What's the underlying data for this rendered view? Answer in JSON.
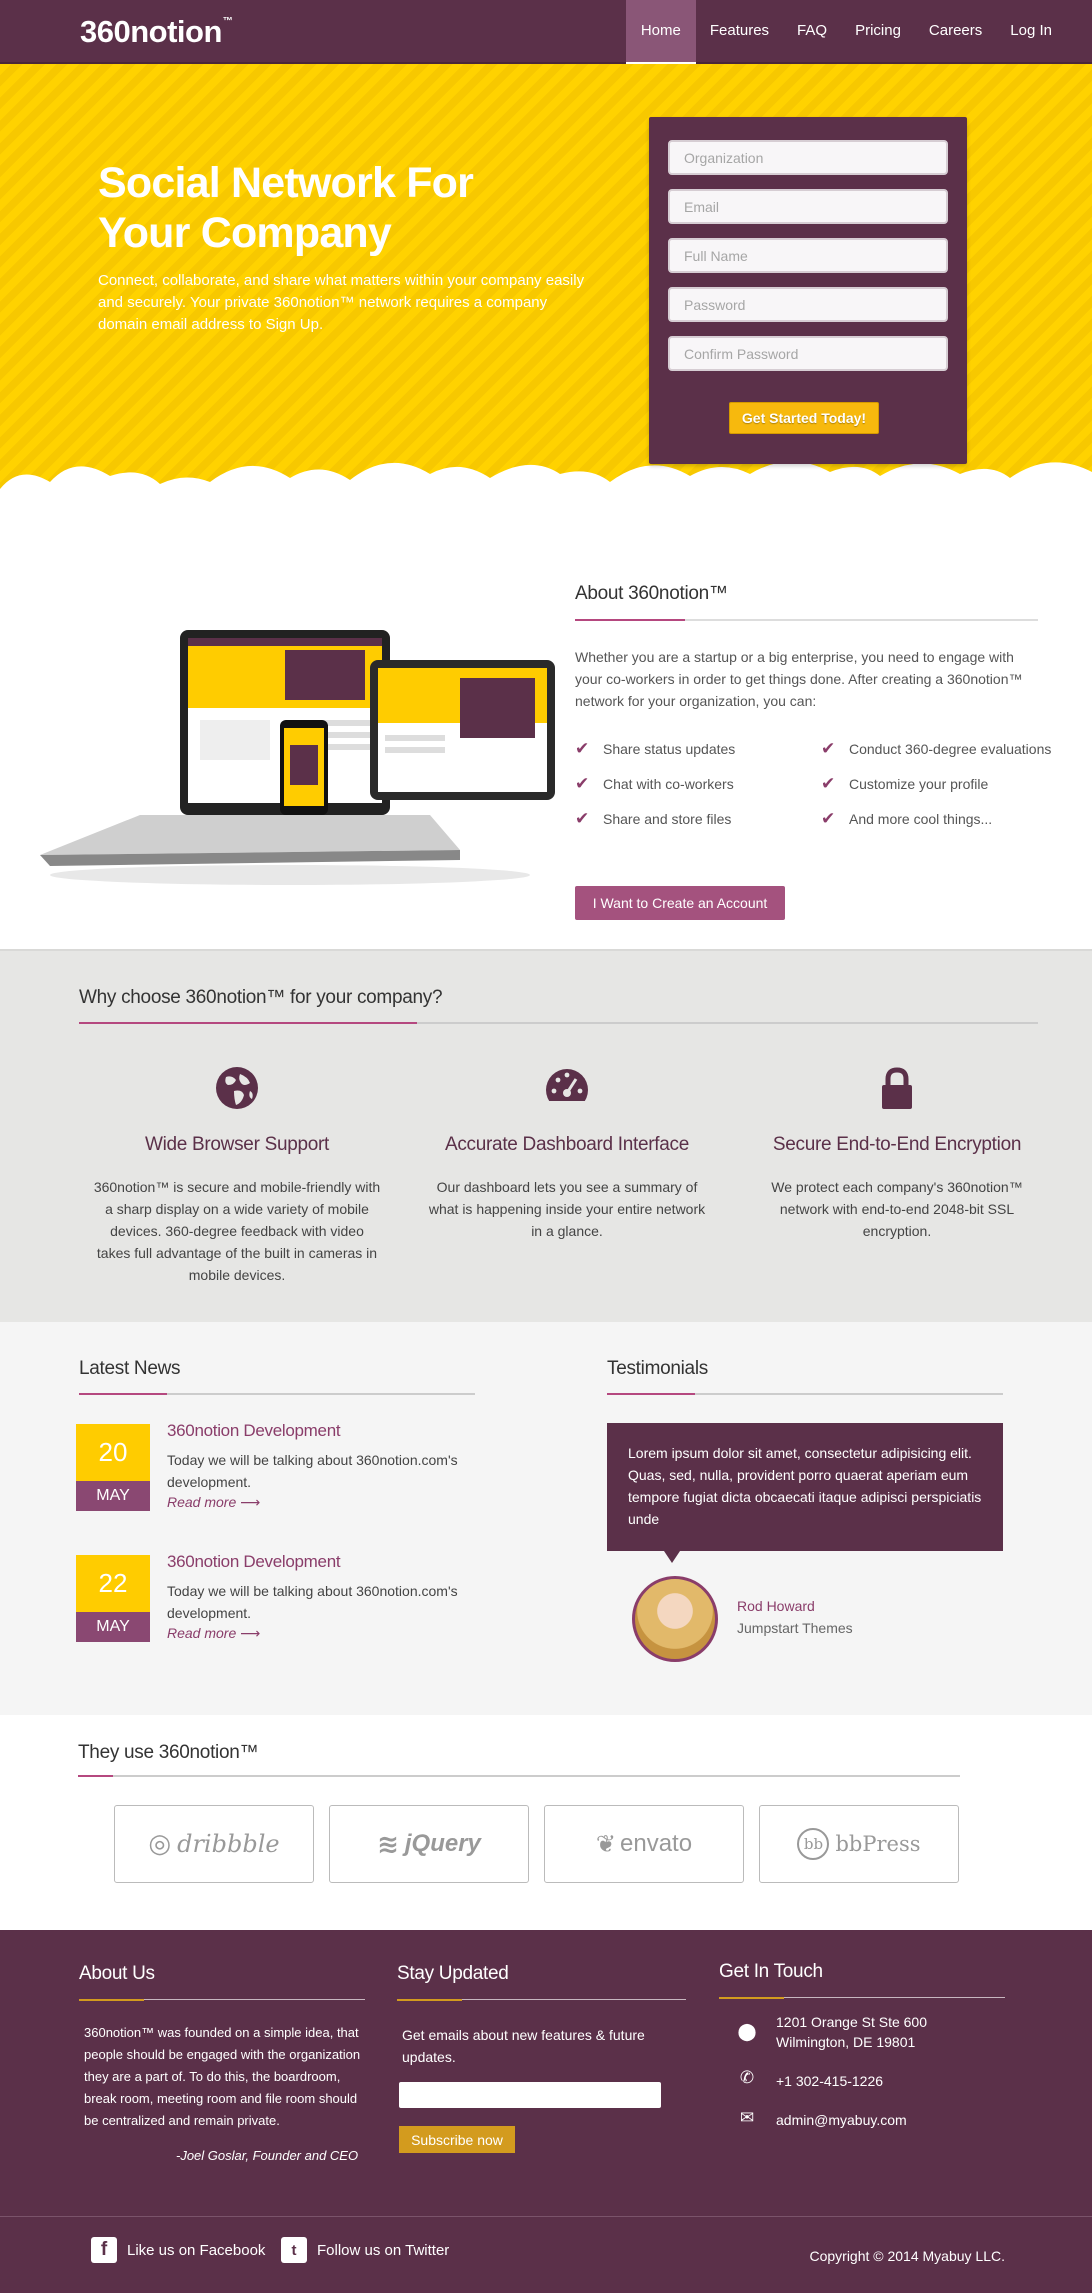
{
  "header": {
    "logo": "360notion",
    "logo_tm": "™",
    "nav": [
      "Home",
      "Features",
      "FAQ",
      "Pricing",
      "Careers",
      "Log In"
    ]
  },
  "hero": {
    "title": "Social Network For Your Company",
    "description": "Connect, collaborate, and share what matters within your company easily and securely. Your private 360notion™ network requires a company domain email address to Sign Up.",
    "form": {
      "organization_placeholder": "Organization",
      "email_placeholder": "Email",
      "fullname_placeholder": "Full Name",
      "password_placeholder": "Password",
      "confirm_placeholder": "Confirm Password",
      "submit_label": "Get Started Today!"
    }
  },
  "about": {
    "title": "About 360notion™",
    "text": "Whether you are a startup or a big enterprise, you need to engage with your co-workers in order to get things done. After creating a 360notion™ network for your organization, you can:",
    "items": [
      "Share status updates",
      "Conduct 360-degree  evaluations",
      "Chat with co-workers",
      "Customize your profile",
      "Share and store files",
      "And more cool things..."
    ],
    "button": "I Want to Create an Account",
    "check_icon": "check-icon"
  },
  "why": {
    "title": "Why choose 360notion™  for your company?",
    "features": [
      {
        "icon": "globe-icon",
        "title": "Wide Browser Support",
        "text": "360notion™ is secure and mobile-friendly with a sharp display on a wide variety of mobile devices. 360-degree feedback with video takes full advantage of the built in cameras in mobile devices."
      },
      {
        "icon": "dashboard-icon",
        "title": "Accurate Dashboard Interface",
        "text": "Our dashboard lets you see a summary of what is happening inside your entire network in a glance."
      },
      {
        "icon": "lock-icon",
        "title": "Secure End-to-End Encryption",
        "text": "We protect each company's 360notion™ network with end-to-end 2048-bit SSL encryption."
      }
    ]
  },
  "news": {
    "title": "Latest News",
    "items": [
      {
        "day": "20",
        "month": "MAY",
        "heading": "360notion Development",
        "text": "Today we will be talking about 360notion.com's development.",
        "more": "Read more ⟶"
      },
      {
        "day": "22",
        "month": "MAY",
        "heading": "360notion Development",
        "text": "Today we will be talking about 360notion.com's development.",
        "more": "Read more ⟶"
      }
    ]
  },
  "testimonials": {
    "title": "Testimonials",
    "quote": "Lorem ipsum dolor sit amet, consectetur adipisicing elit. Quas, sed, nulla, provident porro quaerat aperiam eum tempore fugiat dicta obcaecati itaque adipisci perspiciatis unde",
    "name": "Rod Howard",
    "company": "Jumpstart Themes"
  },
  "clients": {
    "title": "They use 360notion™",
    "logos": [
      "dribbble",
      "jQuery",
      "envato",
      "bbPress"
    ]
  },
  "footer": {
    "about_title": "About Us",
    "about_text": "360notion™ was founded on a simple idea, that people should be engaged with the organization they are a part of. To do this, the boardroom, break room, meeting room and file room should be centralized and remain private.",
    "about_author": "-Joel Goslar, Founder and CEO",
    "stay_title": "Stay Updated",
    "stay_text": "Get emails about new features & future updates.",
    "subscribe": "Subscribe now",
    "touch_title": "Get In Touch",
    "address1": "1201 Orange St Ste 600",
    "address2": "Wilmington, DE 19801",
    "phone": "+1 302-415-1226",
    "email": "admin@myabuy.com",
    "facebook": "Like us on Facebook",
    "twitter": "Follow us on Twitter",
    "copyright": "Copyright © 2014 Myabuy LLC."
  },
  "colors": {
    "brand_purple": "#5b3049",
    "accent_yellow": "#ffcc00",
    "button_pink": "#a4527e",
    "gold": "#d39b1e"
  }
}
